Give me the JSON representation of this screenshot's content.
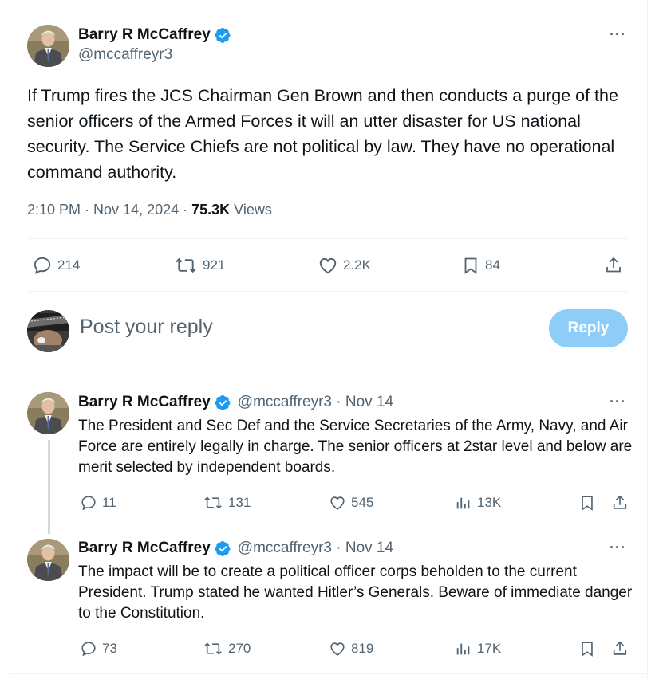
{
  "main_tweet": {
    "author": "Barry R McCaffrey",
    "handle": "@mccaffreyr3",
    "text": "If Trump fires the JCS Chairman Gen Brown and then conducts a purge of the senior officers of the Armed Forces it will an utter disaster for US national security.  The Service Chiefs are not political by law. They have no operational command authority.",
    "time": "2:10 PM · Nov 14, 2024 · ",
    "views_count": "75.3K",
    "views_label": " Views",
    "more_icon": "···",
    "stats": {
      "replies": "214",
      "reposts": "921",
      "likes": "2.2K",
      "bookmarks": "84"
    }
  },
  "compose": {
    "placeholder": "Post your reply",
    "button_label": "Reply",
    "button_color": "#8ecdf8"
  },
  "replies": [
    {
      "author": "Barry R McCaffrey",
      "handle_date": "@mccaffreyr3 · Nov 14",
      "text": "The President and Sec Def and the Service Secretaries of the Army, Navy, and Air Force are entirely legally in charge. The senior officers at 2star level and below are merit selected by independent boards.",
      "more_icon": "···",
      "stats": {
        "replies": "11",
        "reposts": "131",
        "likes": "545",
        "views": "13K"
      }
    },
    {
      "author": "Barry R McCaffrey",
      "handle_date": "@mccaffreyr3 · Nov 14",
      "text": "The impact will be to create a political officer corps beholden to the current President.  Trump stated he wanted Hitler’s Generals. Beware of immediate danger to the Constitution.",
      "more_icon": "···",
      "stats": {
        "replies": "73",
        "reposts": "270",
        "likes": "819",
        "views": "17K"
      }
    }
  ],
  "colors": {
    "secondary_text": "#536471",
    "primary_text": "#0f1419",
    "verified": "#1d9bf0"
  }
}
